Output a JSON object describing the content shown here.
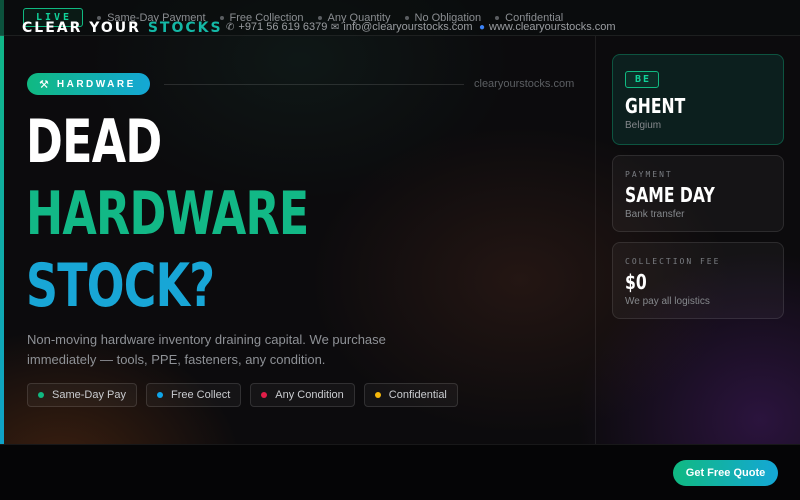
{
  "topbar": {
    "live_label": "LIVE",
    "items": [
      "Same-Day Payment",
      "Free Collection",
      "Any Quantity",
      "No Obligation",
      "Confidential"
    ]
  },
  "hero": {
    "tag_label": "HARDWARE",
    "tag_icon": "wrench-icon",
    "site": "clearyourstocks.com",
    "headline": [
      "DEAD",
      "HARDWARE",
      "STOCK?"
    ],
    "lead": "Non-moving hardware inventory draining capital. We purchase immediately — tools, PPE, fasteners, any condition.",
    "chips": [
      {
        "label": "Same-Day Pay",
        "color": "#10b981"
      },
      {
        "label": "Free Collect",
        "color": "#0ea5e9"
      },
      {
        "label": "Any Condition",
        "color": "#e11d48"
      },
      {
        "label": "Confidential",
        "color": "#f5b70a"
      }
    ]
  },
  "cards": {
    "location": {
      "badge": "BE",
      "value": "GHENT",
      "sub": "Belgium"
    },
    "payment": {
      "label": "PAYMENT",
      "value": "SAME DAY",
      "sub": "Bank transfer"
    },
    "fee": {
      "label": "COLLECTION FEE",
      "value": "$0",
      "sub": "We pay all logistics"
    }
  },
  "footer": {
    "brand_main": "CLEAR YOUR ",
    "brand_highlight": "STOCKS",
    "phone": "+971 56 619 6379",
    "email": "info@clearyourstocks.com",
    "web": "www.clearyourstocks.com",
    "cta": "Get Free Quote"
  },
  "colors": {
    "accent_green": "#10b981",
    "accent_blue": "#18a6d6"
  }
}
